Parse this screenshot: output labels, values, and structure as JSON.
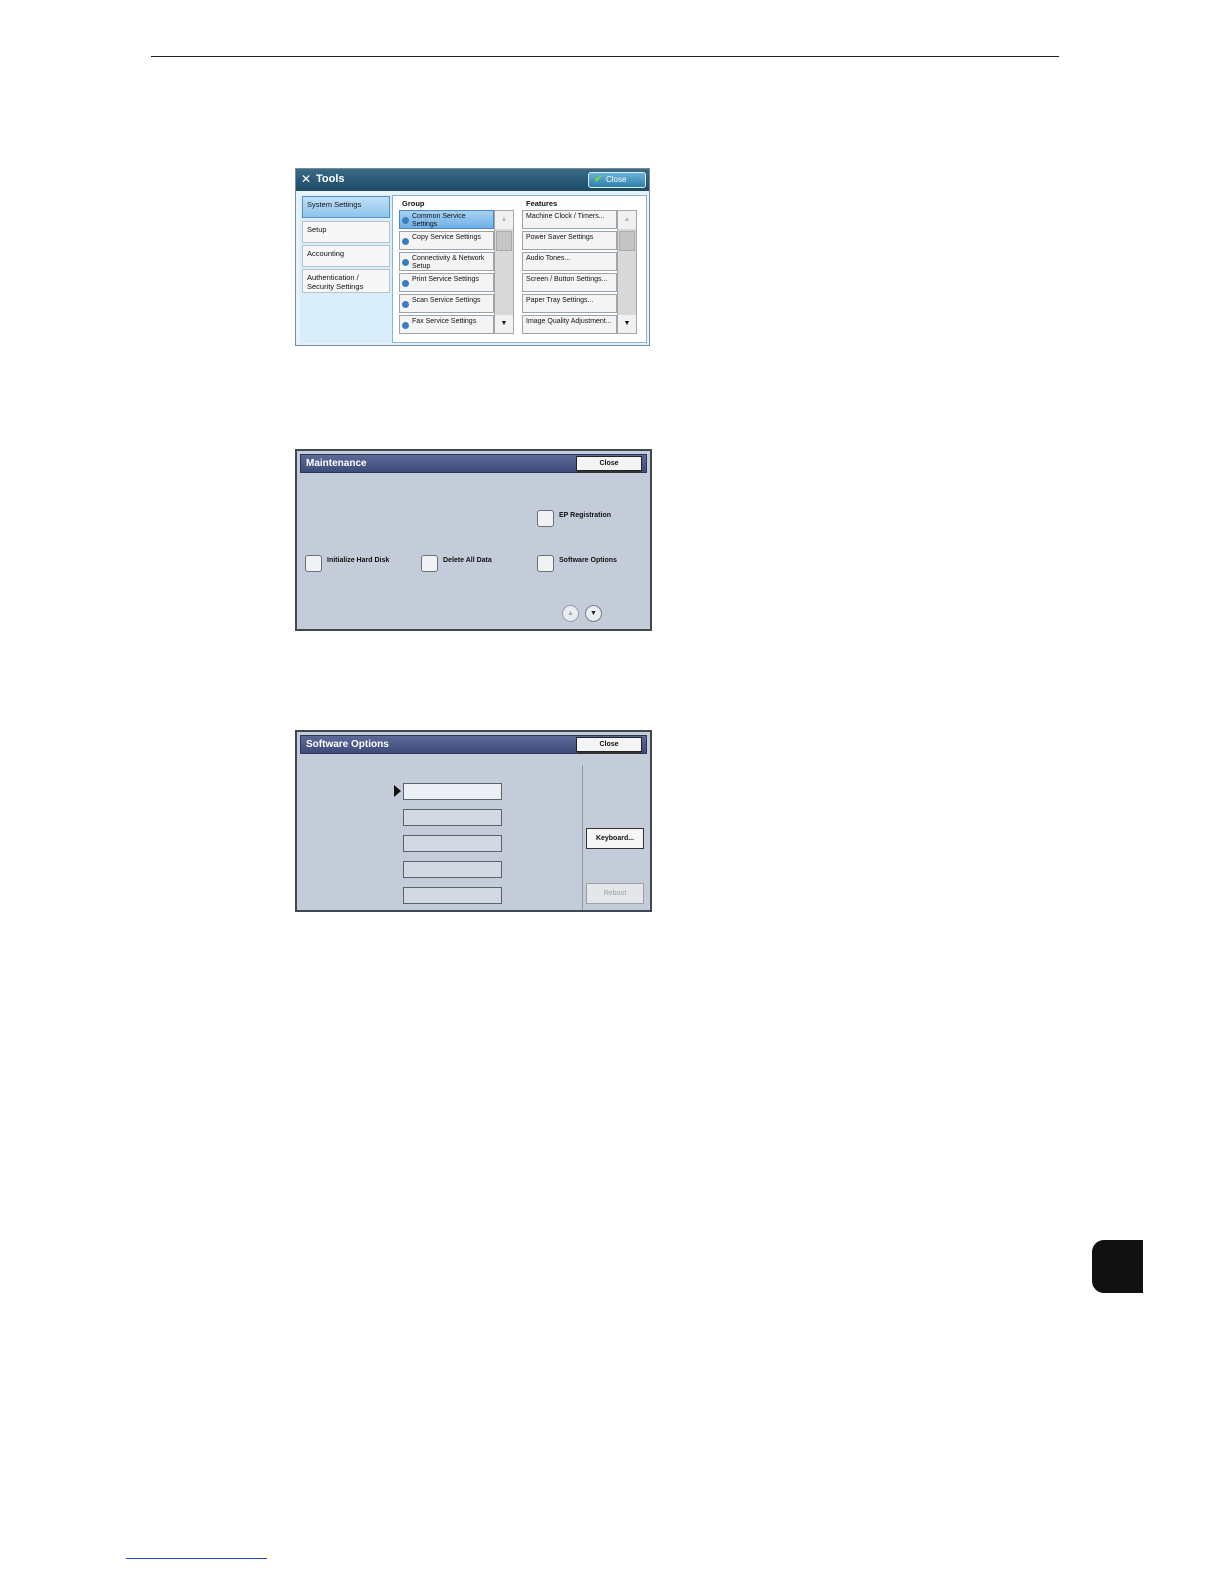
{
  "tools": {
    "title": "Tools",
    "close_label": "Close",
    "side_items": [
      "System Settings",
      "Setup",
      "Accounting",
      "Authentication / Security Settings"
    ],
    "group_header": "Group",
    "features_header": "Features",
    "groups": [
      "Common Service Settings",
      "Copy Service Settings",
      "Connectivity & Network Setup",
      "Print Service Settings",
      "Scan Service Settings",
      "Fax Service Settings"
    ],
    "features": [
      "Machine Clock / Timers...",
      "Power Saver Settings",
      "Audio Tones...",
      "Screen / Button Settings...",
      "Paper Tray Settings...",
      "Image Quality Adjustment..."
    ]
  },
  "maintenance": {
    "title": "Maintenance",
    "close_label": "Close",
    "options": [
      "EP Registration",
      "Initialize Hard Disk",
      "Delete All Data",
      "Software Options"
    ]
  },
  "software_options": {
    "title": "Software Options",
    "close_label": "Close",
    "keyboard_label": "Keyboard...",
    "reboot_label": "Reboot"
  }
}
